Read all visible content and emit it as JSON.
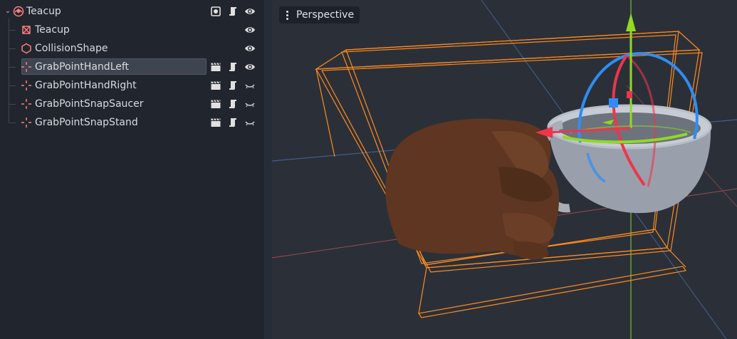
{
  "scene_tree": {
    "nodes": [
      {
        "label": "Teacup",
        "icon": "rigid-body-icon",
        "depth": 0,
        "expanded": true,
        "selected": false,
        "icons": [
          "signal-icon",
          "script-icon",
          "eye-visible-icon"
        ]
      },
      {
        "label": "Teacup",
        "icon": "mesh-instance-icon",
        "depth": 1,
        "selected": false,
        "icons": [
          "eye-visible-icon"
        ]
      },
      {
        "label": "CollisionShape",
        "icon": "collision-shape-icon",
        "depth": 1,
        "selected": false,
        "icons": [
          "eye-visible-icon"
        ]
      },
      {
        "label": "GrabPointHandLeft",
        "icon": "position-3d-icon",
        "depth": 1,
        "selected": true,
        "icons": [
          "clapperboard-icon",
          "script-icon",
          "eye-visible-icon"
        ]
      },
      {
        "label": "GrabPointHandRight",
        "icon": "position-3d-icon",
        "depth": 1,
        "selected": false,
        "icons": [
          "clapperboard-icon",
          "script-icon",
          "eye-hidden-icon"
        ]
      },
      {
        "label": "GrabPointSnapSaucer",
        "icon": "position-3d-icon",
        "depth": 1,
        "selected": false,
        "icons": [
          "clapperboard-icon",
          "script-icon",
          "eye-hidden-icon"
        ]
      },
      {
        "label": "GrabPointSnapStand",
        "icon": "position-3d-icon",
        "depth": 1,
        "selected": false,
        "icons": [
          "clapperboard-icon",
          "script-icon",
          "eye-hidden-icon"
        ]
      }
    ]
  },
  "viewport": {
    "view_menu_label": "Perspective"
  },
  "colors": {
    "panel_bg": "#21262e",
    "viewport_bg": "#2b3038",
    "selection_bg": "#3e4450",
    "node_icon_red": "#fc7f7f",
    "aabb_orange": "#ff8a1f",
    "gizmo_x_red": "#f0344c",
    "gizmo_y_green": "#8fdb20",
    "gizmo_z_blue": "#2f8df5"
  }
}
